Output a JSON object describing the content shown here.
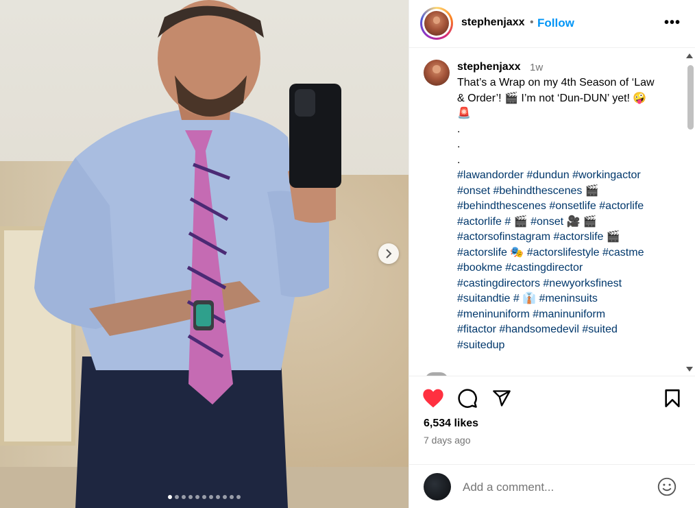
{
  "post": {
    "username": "stephenjaxx",
    "separator": "•",
    "follow_label": "Follow",
    "more_label": "•••",
    "time_ago": "1w",
    "caption_lines": [
      "That’s a Wrap on my 4th Season of ‘Law",
      "& Order’! 🎬 I’m not ‘Dun-DUN’ yet! 🤪",
      "🚨",
      ".",
      ".",
      "."
    ],
    "hashtag_lines": [
      "#lawandorder #dundun #workingactor",
      "#onset #behindthescenes 🎬",
      "#behindthescenes #onsetlife #actorlife",
      "#actorlife # 🎬 #onset 🎥 🎬",
      "#actorsofinstagram #actorslife 🎬",
      "#actorslife 🎭 #actorslifestyle #castme",
      "#bookme #castingdirector",
      "#castingdirectors #newyorksfinest",
      "#suitandtie # 👔 #meninsuits",
      "#meninuniform #maninuniform",
      "#fitactor #handsomedevil #suited",
      "#suitedup"
    ],
    "likes": "6,534 likes",
    "date": "7 days ago",
    "comment_placeholder": "Add a comment...",
    "carousel_dots": 11,
    "active_dot": 0
  },
  "colors": {
    "follow": "#0095f6",
    "hashtag": "#00376b",
    "like_heart": "#ff3040",
    "muted": "#737373"
  },
  "icons": [
    "chevron-right-icon",
    "more-icon",
    "heart-icon",
    "comment-icon",
    "share-icon",
    "bookmark-icon",
    "emoji-icon"
  ]
}
